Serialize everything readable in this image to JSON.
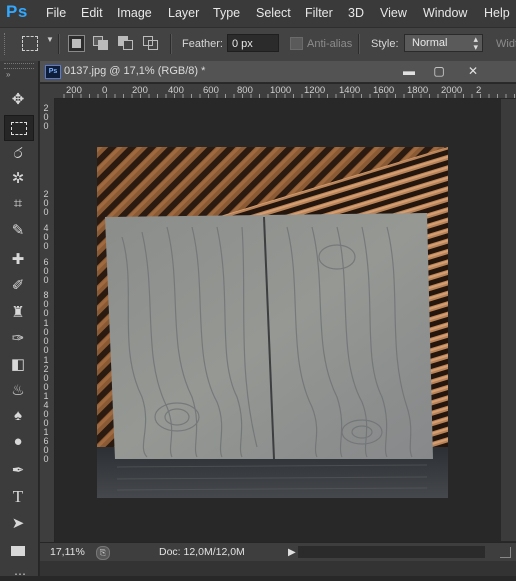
{
  "app": {
    "logo": "Ps"
  },
  "menu": [
    "File",
    "Edit",
    "Image",
    "Layer",
    "Type",
    "Select",
    "Filter",
    "3D",
    "View",
    "Window",
    "Help"
  ],
  "options": {
    "feather_label": "Feather:",
    "feather_value": "0 px",
    "antialias_label": "Anti-alias",
    "style_label": "Style:",
    "style_value": "Normal",
    "width_label": "Widt"
  },
  "document": {
    "tab_title": "0137.jpg @ 17,1% (RGB/8) *",
    "tab_icon": "Ps"
  },
  "ruler_h": [
    "200",
    "0",
    "200",
    "400",
    "600",
    "800",
    "1000",
    "1200",
    "1400",
    "1600",
    "1800",
    "2000",
    "2"
  ],
  "ruler_v": [
    "2\n0\n0",
    "2\n0\n0",
    "4\n0\n0",
    "6\n0\n0",
    "8\n0\n0",
    "1\n0\n0\n0",
    "1\n2\n0\n0",
    "1\n4\n0\n0",
    "1\n6\n0\n0"
  ],
  "status": {
    "zoom": "17,11%",
    "doc_info": "Doc: 12,0M/12,0M"
  },
  "icons": [
    "move-icon",
    "marquee-icon",
    "lasso-icon",
    "magic-wand-icon",
    "crop-icon",
    "eyedropper-icon",
    "healing-icon",
    "brush-icon",
    "stamp-icon",
    "history-brush-icon",
    "eraser-icon",
    "paint-bucket-icon",
    "blur-icon",
    "dodge-icon",
    "pen-icon",
    "type-icon",
    "path-select-icon",
    "rectangle-icon"
  ]
}
